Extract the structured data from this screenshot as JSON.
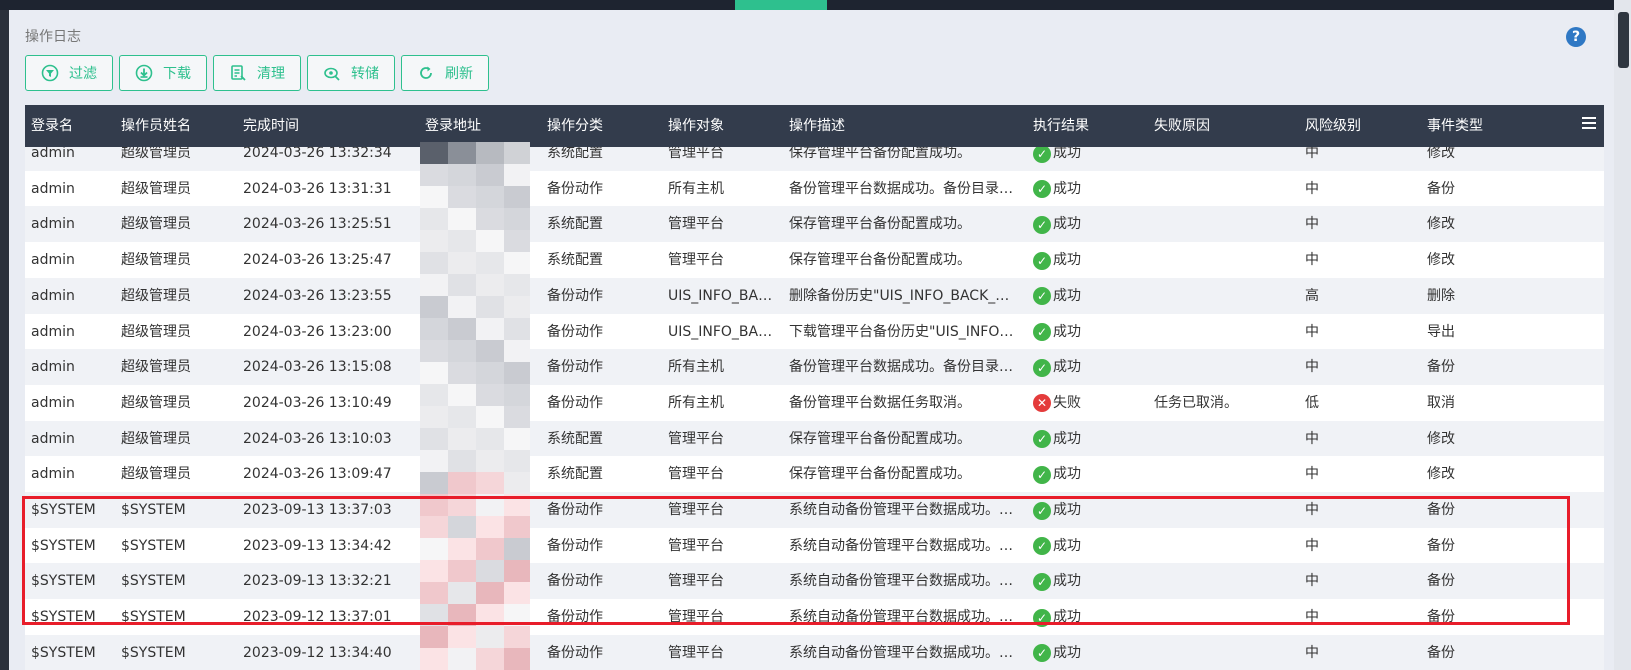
{
  "panel": {
    "title": "操作日志"
  },
  "toolbar": {
    "filter": "过滤",
    "download": "下载",
    "clear": "清理",
    "dump": "转储",
    "refresh": "刷新"
  },
  "table": {
    "headers": [
      "登录名",
      "操作员姓名",
      "完成时间",
      "登录地址",
      "操作分类",
      "操作对象",
      "操作描述",
      "执行结果",
      "失败原因",
      "风险级别",
      "事件类型"
    ],
    "rows": [
      {
        "login": "admin",
        "operator": "超级管理员",
        "time": "2024-03-26 13:32:34",
        "category": "系统配置",
        "target": "管理平台",
        "desc": "保存管理平台备份配置成功。",
        "result": "成功",
        "status": "ok",
        "reason": "",
        "risk": "中",
        "event": "修改"
      },
      {
        "login": "admin",
        "operator": "超级管理员",
        "time": "2024-03-26 13:31:31",
        "category": "备份动作",
        "target": "所有主机",
        "desc": "备份管理平台数据成功。备份目录…",
        "result": "成功",
        "status": "ok",
        "reason": "",
        "risk": "中",
        "event": "备份"
      },
      {
        "login": "admin",
        "operator": "超级管理员",
        "time": "2024-03-26 13:25:51",
        "category": "系统配置",
        "target": "管理平台",
        "desc": "保存管理平台备份配置成功。",
        "result": "成功",
        "status": "ok",
        "reason": "",
        "risk": "中",
        "event": "修改"
      },
      {
        "login": "admin",
        "operator": "超级管理员",
        "time": "2024-03-26 13:25:47",
        "category": "系统配置",
        "target": "管理平台",
        "desc": "保存管理平台备份配置成功。",
        "result": "成功",
        "status": "ok",
        "reason": "",
        "risk": "中",
        "event": "修改"
      },
      {
        "login": "admin",
        "operator": "超级管理员",
        "time": "2024-03-26 13:23:55",
        "category": "备份动作",
        "target": "UIS_INFO_BA…",
        "desc": "删除备份历史\"UIS_INFO_BACK_…",
        "result": "成功",
        "status": "ok",
        "reason": "",
        "risk": "高",
        "event": "删除"
      },
      {
        "login": "admin",
        "operator": "超级管理员",
        "time": "2024-03-26 13:23:00",
        "category": "备份动作",
        "target": "UIS_INFO_BA…",
        "desc": "下载管理平台备份历史\"UIS_INFO…",
        "result": "成功",
        "status": "ok",
        "reason": "",
        "risk": "中",
        "event": "导出"
      },
      {
        "login": "admin",
        "operator": "超级管理员",
        "time": "2024-03-26 13:15:08",
        "category": "备份动作",
        "target": "所有主机",
        "desc": "备份管理平台数据成功。备份目录…",
        "result": "成功",
        "status": "ok",
        "reason": "",
        "risk": "中",
        "event": "备份"
      },
      {
        "login": "admin",
        "operator": "超级管理员",
        "time": "2024-03-26 13:10:49",
        "category": "备份动作",
        "target": "所有主机",
        "desc": "备份管理平台数据任务取消。",
        "result": "失败",
        "status": "fail",
        "reason": "任务已取消。",
        "risk": "低",
        "event": "取消"
      },
      {
        "login": "admin",
        "operator": "超级管理员",
        "time": "2024-03-26 13:10:03",
        "category": "系统配置",
        "target": "管理平台",
        "desc": "保存管理平台备份配置成功。",
        "result": "成功",
        "status": "ok",
        "reason": "",
        "risk": "中",
        "event": "修改"
      },
      {
        "login": "admin",
        "operator": "超级管理员",
        "time": "2024-03-26 13:09:47",
        "category": "系统配置",
        "target": "管理平台",
        "desc": "保存管理平台备份配置成功。",
        "result": "成功",
        "status": "ok",
        "reason": "",
        "risk": "中",
        "event": "修改"
      },
      {
        "login": "$SYSTEM",
        "operator": "$SYSTEM",
        "time": "2023-09-13 13:37:03",
        "category": "备份动作",
        "target": "管理平台",
        "desc": "系统自动备份管理平台数据成功。…",
        "result": "成功",
        "status": "ok",
        "reason": "",
        "risk": "中",
        "event": "备份"
      },
      {
        "login": "$SYSTEM",
        "operator": "$SYSTEM",
        "time": "2023-09-13 13:34:42",
        "category": "备份动作",
        "target": "管理平台",
        "desc": "系统自动备份管理平台数据成功。…",
        "result": "成功",
        "status": "ok",
        "reason": "",
        "risk": "中",
        "event": "备份"
      },
      {
        "login": "$SYSTEM",
        "operator": "$SYSTEM",
        "time": "2023-09-13 13:32:21",
        "category": "备份动作",
        "target": "管理平台",
        "desc": "系统自动备份管理平台数据成功。…",
        "result": "成功",
        "status": "ok",
        "reason": "",
        "risk": "中",
        "event": "备份"
      },
      {
        "login": "$SYSTEM",
        "operator": "$SYSTEM",
        "time": "2023-09-12 13:37:01",
        "category": "备份动作",
        "target": "管理平台",
        "desc": "系统自动备份管理平台数据成功。…",
        "result": "成功",
        "status": "ok",
        "reason": "",
        "risk": "中",
        "event": "备份"
      },
      {
        "login": "$SYSTEM",
        "operator": "$SYSTEM",
        "time": "2023-09-12 13:34:40",
        "category": "备份动作",
        "target": "管理平台",
        "desc": "系统自动备份管理平台数据成功。…",
        "result": "成功",
        "status": "ok",
        "reason": "",
        "risk": "中",
        "event": "备份"
      }
    ]
  },
  "colors": {
    "accent": "#2ec08e",
    "header_bg": "#333c4c",
    "success": "#41b549",
    "failure": "#e43b3b",
    "highlight": "#e81d2a"
  }
}
